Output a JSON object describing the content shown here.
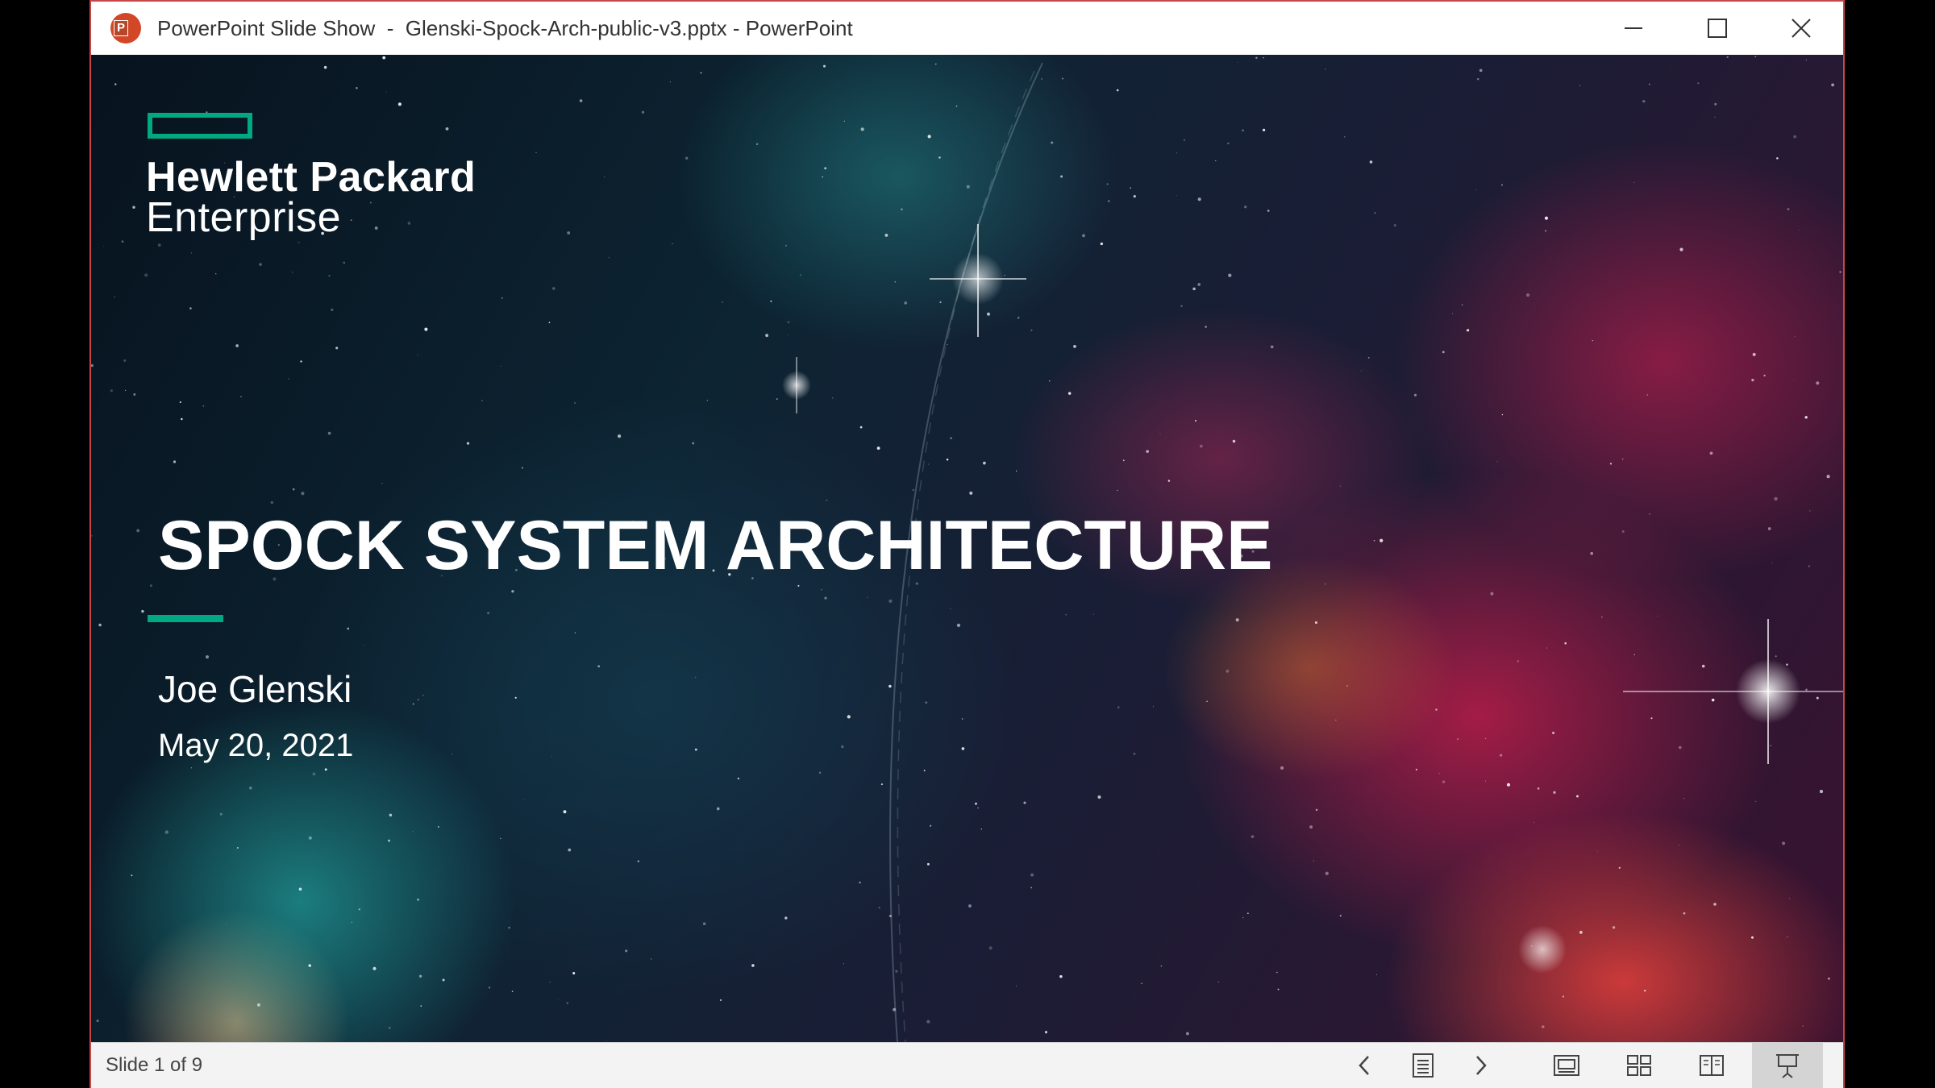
{
  "window": {
    "title": "PowerPoint Slide Show  -  Glenski-Spock-Arch-public-v3.pptx - PowerPoint",
    "app_icon": "powerpoint-icon",
    "controls": [
      "minimize-icon",
      "maximize-icon",
      "close-icon"
    ]
  },
  "slide": {
    "logo_line1": "Hewlett Packard",
    "logo_line2": "Enterprise",
    "title": "SPOCK SYSTEM ARCHITECTURE",
    "presenter": "Joe Glenski",
    "date": "May 20, 2021",
    "accent_color": "#01a982"
  },
  "status_bar": {
    "slide_counter": "Slide 1 of 9",
    "icons": [
      "chevron-left-icon",
      "notes-icon",
      "chevron-right-icon",
      "normal-view-icon",
      "slide-sorter-icon",
      "reading-view-icon",
      "slideshow-icon"
    ]
  },
  "colors": {
    "window_border": "#c8464a",
    "brand_green": "#01a982",
    "powerpoint_orange": "#d24726"
  }
}
